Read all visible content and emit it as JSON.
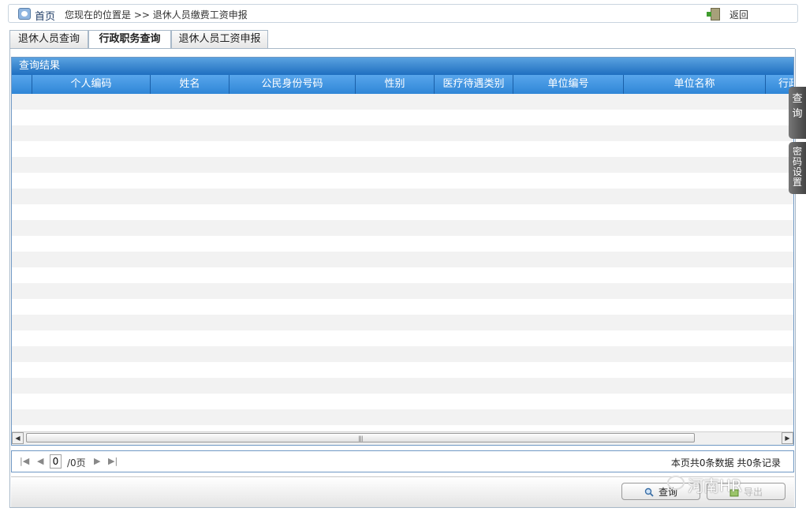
{
  "topbar": {
    "home_label": "首页",
    "breadcrumb": "您现在的位置是 >> 退休人员缴费工资申报",
    "back_label": "返回"
  },
  "tabs": [
    {
      "label": "退休人员查询",
      "active": false
    },
    {
      "label": "行政职务查询",
      "active": true
    },
    {
      "label": "退休人员工资申报",
      "active": false
    }
  ],
  "grid": {
    "title": "查询结果",
    "columns": [
      "",
      "个人编码",
      "姓名",
      "公民身份号码",
      "性别",
      "医疗待遇类别",
      "单位编号",
      "单位名称",
      "行政"
    ],
    "rows": []
  },
  "pager": {
    "current_page": "0",
    "total_pages_label": "/0页",
    "summary": "本页共0条数据 共0条记录"
  },
  "buttons": {
    "query": "查询",
    "export": "导出"
  },
  "side_tabs": {
    "query": "查\n询",
    "password": "密码设置"
  },
  "watermark": "河南HR",
  "colors": {
    "header_blue": "#2f86d6",
    "title_blue": "#1f6fc0",
    "row_alt": "#f2f2f2"
  }
}
